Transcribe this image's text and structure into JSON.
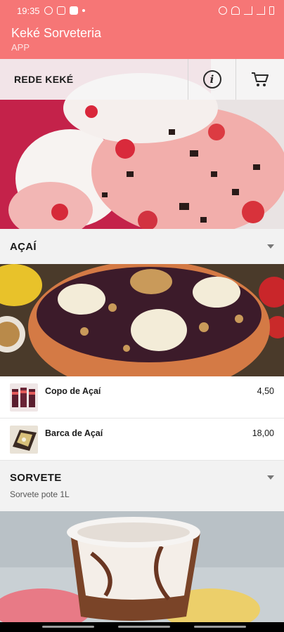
{
  "status_bar": {
    "time": "19:35"
  },
  "header": {
    "title": "Keké Sorveteria",
    "subtitle": "APP"
  },
  "toolbar": {
    "tab_label": "REDE KEKÉ",
    "info_icon": "info-icon",
    "cart_icon": "cart-icon"
  },
  "sections": [
    {
      "title": "AÇAÍ",
      "products": [
        {
          "name": "Copo de Açaí",
          "price": "4,50"
        },
        {
          "name": "Barca de Açaí",
          "price": "18,00"
        }
      ]
    },
    {
      "title": "SORVETE",
      "description": "Sorvete pote 1L"
    }
  ],
  "colors": {
    "brand": "#f67676",
    "section_bg": "#f2f2f2"
  }
}
